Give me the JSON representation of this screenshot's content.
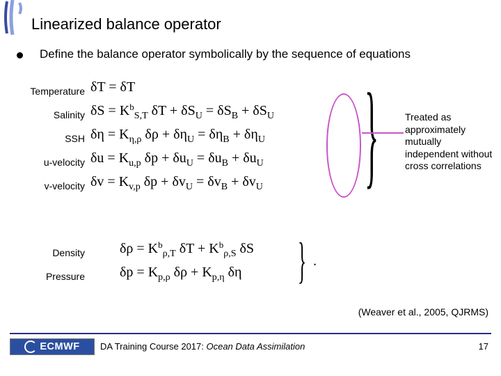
{
  "title": "Linearized balance operator",
  "bullet": "Define the balance operator symbolically by the sequence of equations",
  "vars1": {
    "temperature": "Temperature",
    "salinity": "Salinity",
    "ssh": "SSH",
    "u": "u-velocity",
    "v": "v-velocity"
  },
  "callout": "Treated as approximately mutually independent without cross correlations",
  "vars2": {
    "density": "Density",
    "pressure": "Pressure"
  },
  "citation": "(Weaver et al., 2005, QJRMS)",
  "footer": {
    "logo": "ECMWF",
    "text_plain": "DA Training Course 2017: ",
    "text_ital": "Ocean Data Assimilation",
    "page": "17"
  },
  "eq1": {
    "r1": "δT   =   δT",
    "r2a": "δS   =   K",
    "r2b": " δT   +   δS",
    "r2c": "   =   δS",
    "r2d": "   +   δS",
    "r3a": "δη   =   K",
    "r3b": " δρ   +   δη",
    "r3c": "   =   δη",
    "r3d": "   +   δη",
    "r4a": "δu   =   K",
    "r4b": " δp   +   δu",
    "r4c": "   =   δu",
    "r4d": "   +   δu",
    "r5a": "δv   =   K",
    "r5b": " δp   +   δv",
    "r5c": "   =   δv",
    "r5d": "   +   δv"
  },
  "eq2": {
    "r1a": "δρ   =   K",
    "r1b": " δT   +   K",
    "r1c": " δS",
    "r2a": "δp   =   K",
    "r2b": " δρ   +   K",
    "r2c": " δη"
  }
}
